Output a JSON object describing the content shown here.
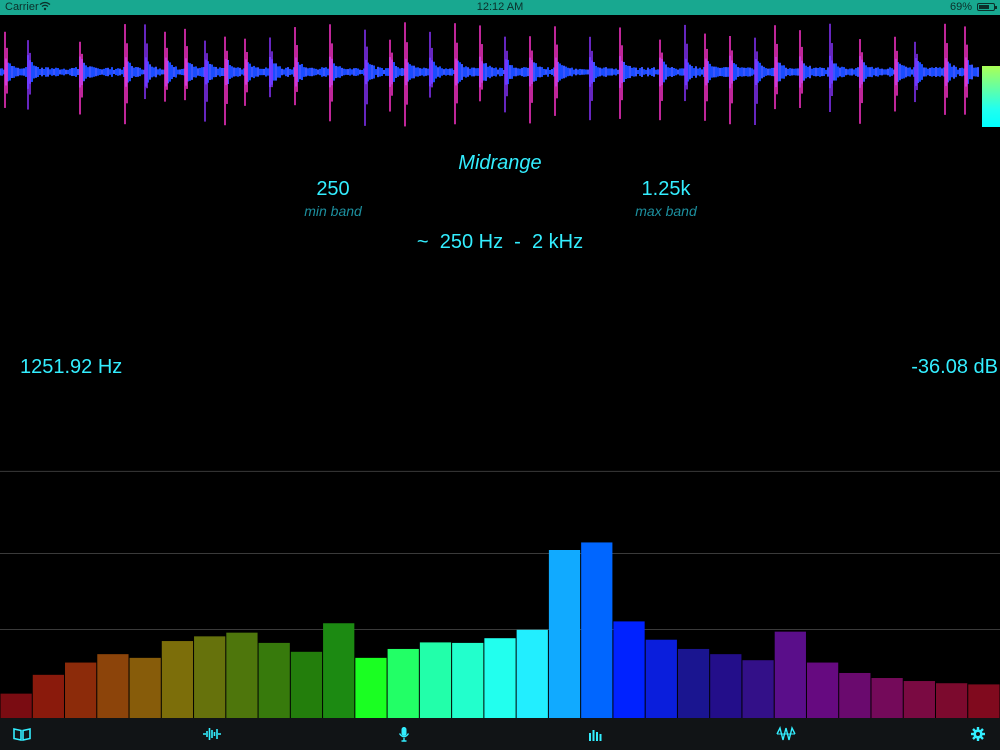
{
  "status_bar": {
    "carrier": "Carrier",
    "time": "12:12 AM",
    "battery": "69%",
    "battery_level": 0.69
  },
  "band": {
    "name": "Midrange",
    "min_value": "250",
    "min_caption": "min band",
    "max_value": "1.25k",
    "max_caption": "max band",
    "range": "~  250 Hz  -  2 kHz"
  },
  "readout": {
    "frequency": "1251.92 Hz",
    "level": "-36.08 dB"
  },
  "spectrum": {
    "max": 1.0,
    "values": [
      0.145,
      0.257,
      0.33,
      0.38,
      0.358,
      0.458,
      0.486,
      0.508,
      0.447,
      0.394,
      0.564,
      0.358,
      0.411,
      0.45,
      0.447,
      0.475,
      0.525,
      1.0,
      1.045,
      0.575,
      0.466,
      0.411,
      0.38,
      0.344,
      0.514,
      0.33,
      0.268,
      0.238,
      0.22,
      0.207,
      0.2
    ],
    "colors": [
      "#7a0c12",
      "#8a1a0c",
      "#8c2b0a",
      "#8c440a",
      "#875c0a",
      "#7c6e0a",
      "#66720c",
      "#4e760c",
      "#377a0c",
      "#237e0c",
      "#1c8a12",
      "#1aff22",
      "#22ff66",
      "#22ffaa",
      "#22ffcc",
      "#22ffee",
      "#22eeff",
      "#11aaff",
      "#0066ff",
      "#0022ff",
      "#0a1edc",
      "#1a1590",
      "#230e8a",
      "#331088",
      "#5a0e8a",
      "#660a80",
      "#6a0a6e",
      "#740a5a",
      "#7a0a42",
      "#7c0a2e",
      "#800a1e"
    ],
    "grid_fractions": [
      0.35,
      0.65,
      0.975
    ]
  },
  "toolbar": {
    "icons": [
      "book-icon",
      "waveform-icon",
      "microphone-icon",
      "spectrum-icon",
      "oscilloscope-icon",
      "gear-icon"
    ],
    "active_color": "#33eeff"
  },
  "waveform": {
    "center_color": "#1a4cff",
    "spike_color": "#ff33cc"
  }
}
